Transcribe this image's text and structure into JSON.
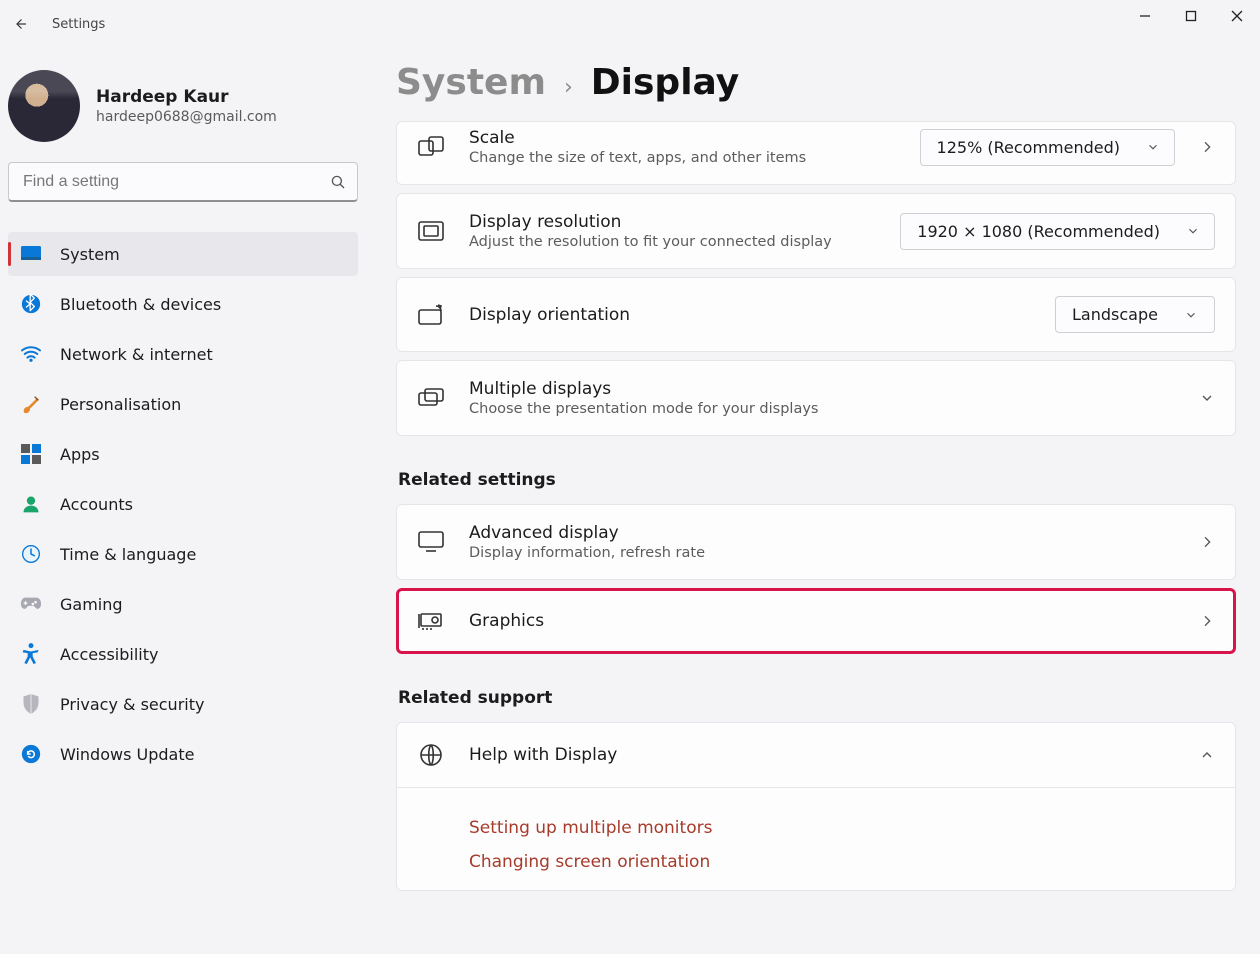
{
  "window": {
    "title": "Settings"
  },
  "user": {
    "name": "Hardeep Kaur",
    "email": "hardeep0688@gmail.com"
  },
  "search": {
    "placeholder": "Find a setting"
  },
  "nav": {
    "items": [
      {
        "label": "System"
      },
      {
        "label": "Bluetooth & devices"
      },
      {
        "label": "Network & internet"
      },
      {
        "label": "Personalisation"
      },
      {
        "label": "Apps"
      },
      {
        "label": "Accounts"
      },
      {
        "label": "Time & language"
      },
      {
        "label": "Gaming"
      },
      {
        "label": "Accessibility"
      },
      {
        "label": "Privacy & security"
      },
      {
        "label": "Windows Update"
      }
    ]
  },
  "breadcrumb": {
    "parent": "System",
    "sep": "›",
    "current": "Display"
  },
  "cards": {
    "scale": {
      "title": "Scale",
      "sub": "Change the size of text, apps, and other items",
      "value": "125% (Recommended)"
    },
    "resolution": {
      "title": "Display resolution",
      "sub": "Adjust the resolution to fit your connected display",
      "value": "1920 × 1080 (Recommended)"
    },
    "orientation": {
      "title": "Display orientation",
      "value": "Landscape"
    },
    "multiple": {
      "title": "Multiple displays",
      "sub": "Choose the presentation mode for your displays"
    },
    "advanced": {
      "title": "Advanced display",
      "sub": "Display information, refresh rate"
    },
    "graphics": {
      "title": "Graphics"
    },
    "help": {
      "title": "Help with Display"
    }
  },
  "sections": {
    "related_settings": "Related settings",
    "related_support": "Related support"
  },
  "support_links": {
    "multi": "Setting up multiple monitors",
    "orient": "Changing screen orientation"
  }
}
